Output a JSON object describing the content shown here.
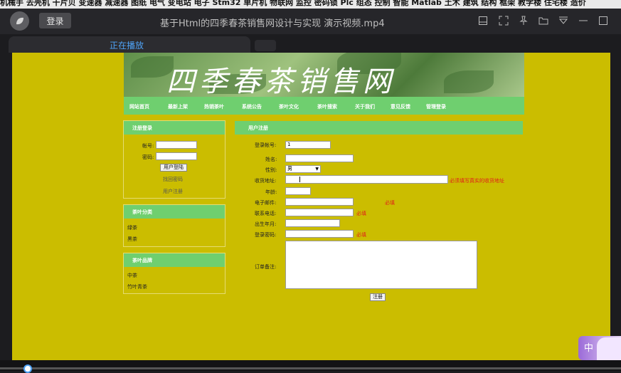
{
  "top_strip": {
    "text": "机械手 去壳机 干片贝 变速器 减速器 图纸 电气 变电站 电子 Stm32 单片机 物联网 监控 密码锁 Plc 组态 控制 智能 Matlab 土木 建筑 结构 框架 教学楼 住宅楼 造价"
  },
  "player": {
    "login_label": "登录",
    "window_title": "基于Html的四季春茶销售网设计与实现 演示视频.mp4",
    "tab_label": "正在播放"
  },
  "site": {
    "banner_title": "四季春茶销售网",
    "nav": [
      "网站首页",
      "最新上架",
      "热销茶叶",
      "系统公告",
      "茶叶文化",
      "茶叶搜索",
      "关于我们",
      "意见反馈",
      "管理登录"
    ],
    "login_box": {
      "title": "注册登录",
      "account_label": "帐号:",
      "password_label": "密码:",
      "login_button": "用户登陆",
      "forgot_link": "找回密码",
      "register_link": "用户注册"
    },
    "category_box": {
      "title": "茶叶分类",
      "items": [
        "绿茶",
        "黑茶"
      ]
    },
    "brand_box": {
      "title": "茶叶品牌",
      "items": [
        "中茶",
        "竹叶青茶"
      ]
    },
    "register": {
      "title": "用户注册",
      "account_label": "登录帐号:",
      "account_value": "1",
      "name_label": "姓名:",
      "gender_label": "性别:",
      "gender_value": "男",
      "address_label": "收货地址:",
      "address_hint": "必须填写真实的收货地址",
      "age_label": "年龄:",
      "email_label": "电子邮件:",
      "email_req": "必填",
      "phone_label": "联系电话:",
      "phone_req": "必填",
      "birth_label": "出生年月:",
      "password_label": "登录密码:",
      "password_req": "必填",
      "remark_label": "订单备注:",
      "submit_label": "注册"
    }
  },
  "mascot_text": "中"
}
